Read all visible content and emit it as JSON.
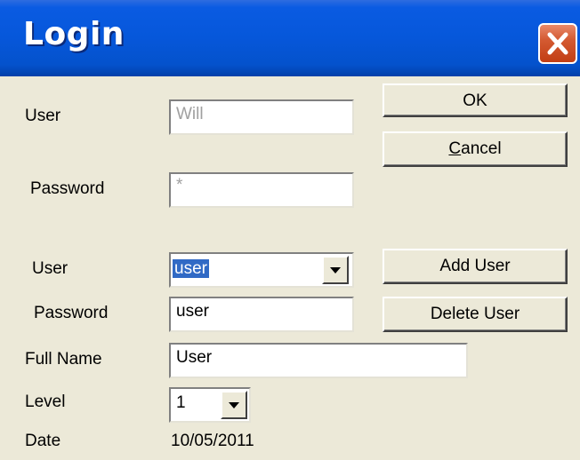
{
  "window": {
    "title": "Login"
  },
  "login": {
    "user_label": "User",
    "user_value": "Will",
    "password_label": "Password",
    "password_value": "*"
  },
  "buttons": {
    "ok": "OK",
    "cancel": "Cancel",
    "add_user": "Add User",
    "delete_user": "Delete User"
  },
  "manage": {
    "user_label": "User",
    "user_selected": "user",
    "password_label": "Password",
    "password_value": "user",
    "fullname_label": "Full Name",
    "fullname_value": "User",
    "level_label": "Level",
    "level_selected": "1",
    "date_label": "Date",
    "date_value": "10/05/2011"
  },
  "icons": {
    "close": "close-icon",
    "dropdown": "chevron-down-icon"
  },
  "colors": {
    "titlebar": "#0657DA",
    "close": "#C23E14",
    "selection": "#316AC5",
    "face": "#ECE9D8"
  }
}
